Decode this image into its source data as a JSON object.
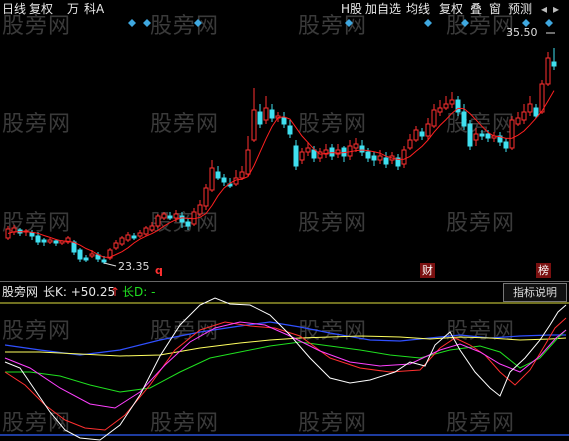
{
  "toolbar": {
    "day_line": "日线",
    "adjust": "复权",
    "unit": "万",
    "tech": "科A",
    "h_stock": "H股",
    "add_fav": "加自选",
    "ma_line": "均线",
    "adjust2": "复权",
    "overlay": "叠",
    "window": "窗",
    "forecast": "预测",
    "prev_icon": "◂",
    "next_icon": "▸"
  },
  "watermark": "股旁网",
  "price_chart": {
    "high_label": "35.50",
    "low_label": "23.35",
    "marker_q": "q",
    "marker_cai": "财",
    "marker_bang": "榜",
    "up_color": "#ff3030",
    "down_color": "#40e0f0",
    "ma_color": "#ff2020"
  },
  "indicator": {
    "name": "股旁网",
    "k_label": "长K: +50.25",
    "k_arrow": "↑",
    "d_label": "长D: -",
    "help_button": "指标说明"
  }
}
